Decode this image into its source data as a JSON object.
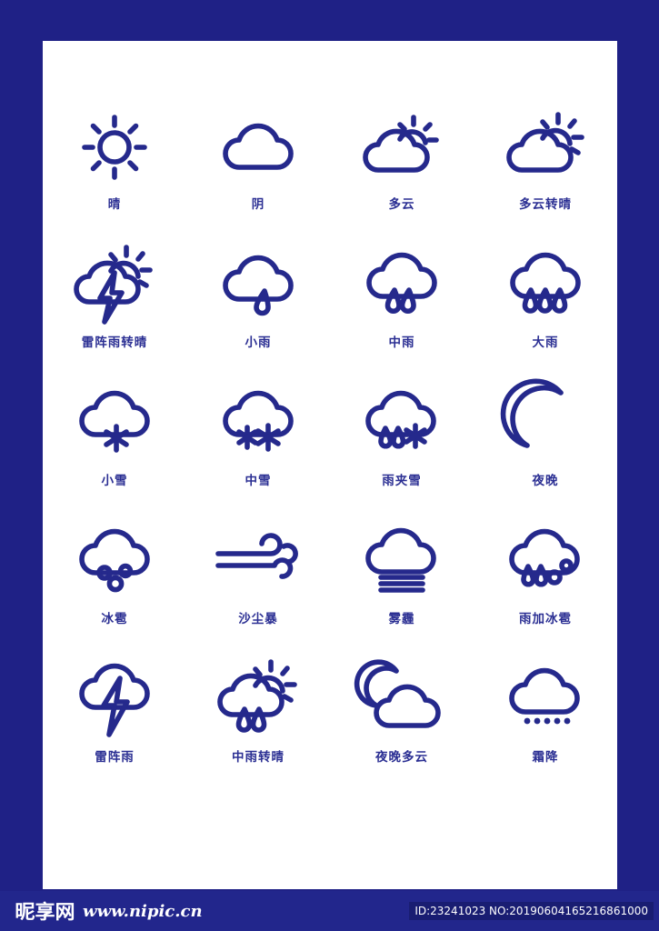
{
  "page": {
    "background_color": "#1f2186",
    "panel_color": "#ffffff",
    "icon_stroke_color": "#25298c",
    "caption_color": "#2b2f93"
  },
  "icons": [
    {
      "id": "sunny",
      "label": "晴",
      "glyph": "sun"
    },
    {
      "id": "overcast",
      "label": "阴",
      "glyph": "cloud"
    },
    {
      "id": "cloudy",
      "label": "多云",
      "glyph": "cloud-sun"
    },
    {
      "id": "cloudy-to-sunny",
      "label": "多云转晴",
      "glyph": "cloud-sun-big"
    },
    {
      "id": "thunder-to-sunny",
      "label": "雷阵雨转晴",
      "glyph": "cloud-sun-bolt"
    },
    {
      "id": "light-rain",
      "label": "小雨",
      "glyph": "cloud-rain-1"
    },
    {
      "id": "moderate-rain",
      "label": "中雨",
      "glyph": "cloud-rain-2"
    },
    {
      "id": "heavy-rain",
      "label": "大雨",
      "glyph": "cloud-rain-3"
    },
    {
      "id": "light-snow",
      "label": "小雪",
      "glyph": "cloud-snow-1"
    },
    {
      "id": "moderate-snow",
      "label": "中雪",
      "glyph": "cloud-snow-2"
    },
    {
      "id": "sleet",
      "label": "雨夹雪",
      "glyph": "cloud-sleet"
    },
    {
      "id": "night",
      "label": "夜晚",
      "glyph": "moon"
    },
    {
      "id": "hail",
      "label": "冰雹",
      "glyph": "cloud-hail"
    },
    {
      "id": "sandstorm",
      "label": "沙尘暴",
      "glyph": "wind"
    },
    {
      "id": "haze",
      "label": "雾霾",
      "glyph": "cloud-fog"
    },
    {
      "id": "rain-and-hail",
      "label": "雨加冰雹",
      "glyph": "cloud-rain-hail"
    },
    {
      "id": "thunderstorm",
      "label": "雷阵雨",
      "glyph": "cloud-bolt"
    },
    {
      "id": "mod-rain-to-sunny",
      "label": "中雨转晴",
      "glyph": "cloud-sun-rain"
    },
    {
      "id": "night-cloudy",
      "label": "夜晚多云",
      "glyph": "moon-cloud"
    },
    {
      "id": "frost",
      "label": "霜降",
      "glyph": "cloud-dots"
    }
  ],
  "footer": {
    "logo_cn": "昵享网",
    "logo_url": "www.nipic.cn",
    "id_text": "ID:23241023 NO:20190604165216861000"
  }
}
